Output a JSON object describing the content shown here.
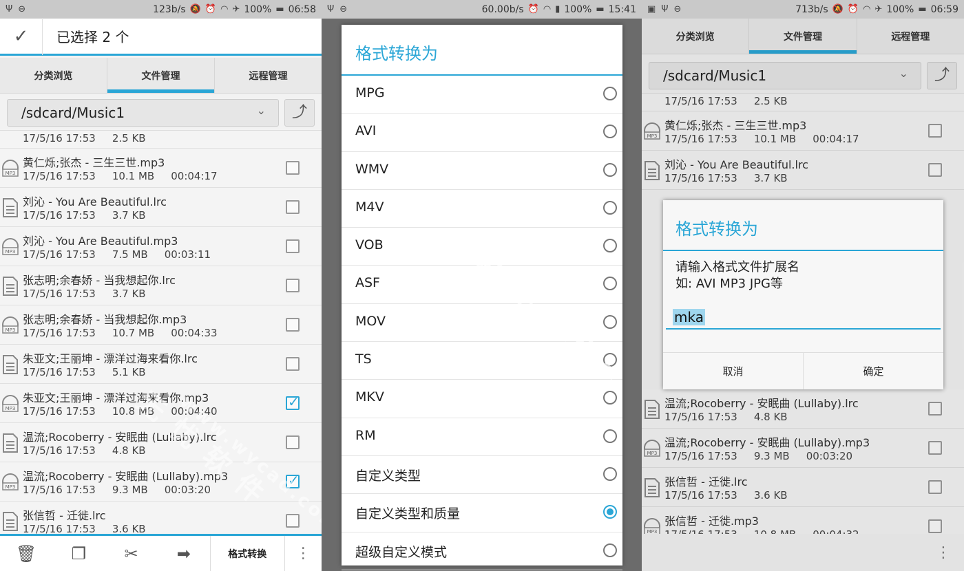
{
  "status": {
    "p1": {
      "speed": "123b/s",
      "battery": "100%",
      "time": "06:58"
    },
    "p2": {
      "speed": "60.00b/s",
      "battery": "100%",
      "time": "15:41"
    },
    "p3": {
      "speed": "713b/s",
      "battery": "100%",
      "time": "06:59"
    }
  },
  "selection": {
    "title": "已选择 2 个"
  },
  "tabs": [
    "分类浏览",
    "文件管理",
    "远程管理"
  ],
  "path": "/sdcard/Music1",
  "files_p1": [
    {
      "name": "",
      "date": "17/5/16 17:53",
      "size": "2.5 KB",
      "duration": "",
      "type": "partial",
      "checked": false
    },
    {
      "name": "黄仁烁;张杰 - 三生三世.mp3",
      "date": "17/5/16 17:53",
      "size": "10.1 MB",
      "duration": "00:04:17",
      "type": "mp3",
      "checked": false
    },
    {
      "name": "刘沁 - You Are Beautiful.lrc",
      "date": "17/5/16 17:53",
      "size": "3.7 KB",
      "duration": "",
      "type": "lrc",
      "checked": false
    },
    {
      "name": "刘沁 - You Are Beautiful.mp3",
      "date": "17/5/16 17:53",
      "size": "7.5 MB",
      "duration": "00:03:11",
      "type": "mp3",
      "checked": false
    },
    {
      "name": "张志明;余春娇 - 当我想起你.lrc",
      "date": "17/5/16 17:53",
      "size": "3.7 KB",
      "duration": "",
      "type": "lrc",
      "checked": false
    },
    {
      "name": "张志明;余春娇 - 当我想起你.mp3",
      "date": "17/5/16 17:53",
      "size": "10.7 MB",
      "duration": "00:04:33",
      "type": "mp3",
      "checked": false
    },
    {
      "name": "朱亚文;王丽坤 - 漂洋过海来看你.lrc",
      "date": "17/5/16 17:53",
      "size": "5.1 KB",
      "duration": "",
      "type": "lrc",
      "checked": false
    },
    {
      "name": "朱亚文;王丽坤 - 漂洋过海来看你.mp3",
      "date": "17/5/16 17:53",
      "size": "10.8 MB",
      "duration": "00:04:40",
      "type": "mp3",
      "checked": true
    },
    {
      "name": "温流;Rocoberry - 安眠曲 (Lullaby).lrc",
      "date": "17/5/16 17:53",
      "size": "4.8 KB",
      "duration": "",
      "type": "lrc",
      "checked": false
    },
    {
      "name": "温流;Rocoberry - 安眠曲 (Lullaby).mp3",
      "date": "17/5/16 17:53",
      "size": "9.3 MB",
      "duration": "00:03:20",
      "type": "mp3",
      "checked": true
    },
    {
      "name": "张信哲 - 迁徙.lrc",
      "date": "17/5/16 17:53",
      "size": "3.6 KB",
      "duration": "",
      "type": "lrc",
      "checked": false
    }
  ],
  "files_p3_top": [
    {
      "name": "",
      "date": "17/5/16 17:53",
      "size": "2.5 KB",
      "duration": "",
      "type": "partial"
    },
    {
      "name": "黄仁烁;张杰 - 三生三世.mp3",
      "date": "17/5/16 17:53",
      "size": "10.1 MB",
      "duration": "00:04:17",
      "type": "mp3"
    },
    {
      "name": "刘沁 - You Are Beautiful.lrc",
      "date": "17/5/16 17:53",
      "size": "3.7 KB",
      "duration": "",
      "type": "lrc"
    }
  ],
  "files_p3_bottom": [
    {
      "name": "温流;Rocoberry - 安眠曲 (Lullaby).lrc",
      "date": "17/5/16 17:53",
      "size": "4.8 KB",
      "duration": "",
      "type": "lrc"
    },
    {
      "name": "温流;Rocoberry - 安眠曲 (Lullaby).mp3",
      "date": "17/5/16 17:53",
      "size": "9.3 MB",
      "duration": "00:03:20",
      "type": "mp3"
    },
    {
      "name": "张信哲 - 迁徙.lrc",
      "date": "17/5/16 17:53",
      "size": "3.6 KB",
      "duration": "",
      "type": "lrc"
    },
    {
      "name": "张信哲 - 迁徙.mp3",
      "date": "17/5/16 17:53",
      "size": "10.8 MB",
      "duration": "00:04:32",
      "type": "mp3"
    }
  ],
  "bottombar": {
    "convert_label": "格式转换"
  },
  "format_dialog": {
    "title": "格式转换为",
    "options": [
      "MPG",
      "AVI",
      "WMV",
      "M4V",
      "VOB",
      "ASF",
      "MOV",
      "TS",
      "MKV",
      "RM",
      "自定义类型",
      "自定义类型和质量",
      "超级自定义模式"
    ],
    "selected_index": 11
  },
  "ext_dialog": {
    "title": "格式转换为",
    "line1": "请输入格式文件扩展名",
    "line2": "如: AVI MP3 JPG等",
    "input_value": "mka",
    "cancel": "取消",
    "ok": "确定"
  },
  "watermark": {
    "text1": "无 忧 软 件",
    "text2": "www.wycad.com"
  },
  "colors": {
    "accent": "#2aa6d6"
  }
}
